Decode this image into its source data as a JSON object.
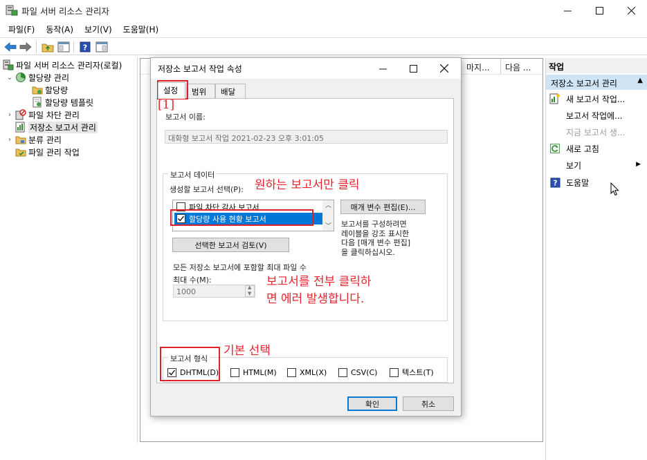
{
  "app": {
    "title": "파일 서버 리소스 관리자"
  },
  "menu": [
    "파일(F)",
    "동작(A)",
    "보기(V)",
    "도움말(H)"
  ],
  "tree": {
    "root": "파일 서버 리소스 관리자(로컬)",
    "quota_mgmt": "할당량 관리",
    "quotas": "할당량",
    "quota_templates": "할당량 템플릿",
    "file_screening": "파일 차단 관리",
    "storage_reports": "저장소 보고서 관리",
    "classification": "분류 관리",
    "file_tasks": "파일 관리 작업"
  },
  "center": {
    "col_last_run": "마지...",
    "col_next_run": "다음 ..."
  },
  "actions": {
    "title": "작업",
    "group": "저장소 보고서 관리",
    "items": [
      {
        "label": "새 보고서 작업..."
      },
      {
        "label": "보고서 작업에..."
      },
      {
        "label": "지금 보고서 생..."
      },
      {
        "label": "새로 고침"
      },
      {
        "label": "보기"
      },
      {
        "label": "도움말"
      }
    ]
  },
  "dialog": {
    "title": "저장소 보고서 작업 속성",
    "tabs": [
      "설정",
      "범위",
      "배달"
    ],
    "report_name_label": "보고서 이름:",
    "report_name_value": "대화형 보고서 작업 2021-02-23 오후 3:01:05",
    "report_data_group": "보고서 데이터",
    "select_reports_label": "생성할 보고서 선택(P):",
    "reports": [
      {
        "label": "파일 차단 감사 보고서",
        "checked": false
      },
      {
        "label": "할당량 사용 현황 보고서",
        "checked": true
      }
    ],
    "edit_params_button": "매개 변수 편집(E)...",
    "hint_text": [
      "보고서를 구성하려면",
      "레이블을 강조 표시한",
      "다음 [매개 변수 편집]",
      "을 클릭하십시오."
    ],
    "review_button": "선택한 보고서 검토(V)",
    "max_files_label": "모든 저장소 보고서에 포함할 최대 파일 수",
    "max_count_label": "최대 수(M):",
    "max_count_value": "1000",
    "format_group": "보고서 형식",
    "formats": [
      {
        "label": "DHTML(D)",
        "checked": true
      },
      {
        "label": "HTML(M)",
        "checked": false
      },
      {
        "label": "XML(X)",
        "checked": false
      },
      {
        "label": "CSV(C)",
        "checked": false
      },
      {
        "label": "텍스트(T)",
        "checked": false
      }
    ],
    "ok_button": "확인",
    "cancel_button": "취소"
  },
  "annotations": {
    "step_1": "[1]",
    "click_wanted_report": "원하는 보고서만 클릭",
    "error_line_1": "보고서를 전부 클릭하",
    "error_line_2": "면 에러 발생합니다.",
    "default_select": "기본 선택"
  },
  "colors": {
    "annotation": "#e8222c",
    "selection": "#0078d7",
    "actions_group_bg": "#cfe4f5"
  }
}
